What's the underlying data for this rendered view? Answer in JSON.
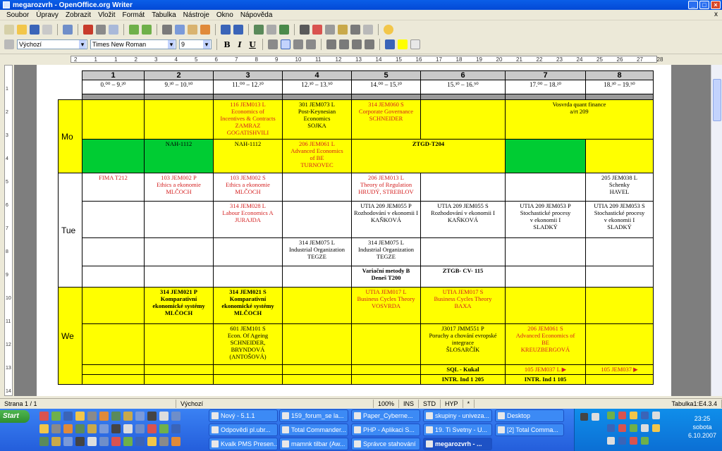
{
  "window": {
    "title": "megarozvrh - OpenOffice.org Writer"
  },
  "menu": [
    "Soubor",
    "Úpravy",
    "Zobrazit",
    "Vložit",
    "Formát",
    "Tabulka",
    "Nástroje",
    "Okno",
    "Nápověda"
  ],
  "menu_close": "x",
  "format_bar": {
    "style": "Výchozí",
    "font": "Times New Roman",
    "size": "9",
    "bold": "B",
    "italic": "I",
    "underline": "U"
  },
  "ruler": [
    "2",
    "1",
    "1",
    "2",
    "3",
    "4",
    "5",
    "6",
    "7",
    "8",
    "9",
    "10",
    "11",
    "12",
    "13",
    "14",
    "15",
    "16",
    "17",
    "18",
    "19",
    "20",
    "21",
    "22",
    "23",
    "24",
    "25",
    "26",
    "27",
    "28"
  ],
  "vruler": [
    "1",
    "2",
    "3",
    "4",
    "5",
    "6",
    "7",
    "8",
    "9",
    "10",
    "11",
    "12",
    "13",
    "14"
  ],
  "table": {
    "columns": [
      "1",
      "2",
      "3",
      "4",
      "5",
      "6",
      "7",
      "8"
    ],
    "times": [
      "0.⁰⁰ – 9.²⁰",
      "9.³⁰ – 10.⁵⁰",
      "11.⁰⁰ – 12.²⁰",
      "12.³⁰ – 13.⁵⁰",
      "14.⁰⁰ – 15.²⁰",
      "15.³⁰ – 16.⁵⁰",
      "17.⁰⁰ – 18.²⁰",
      "18.³⁰ – 19.⁵⁰"
    ],
    "days": {
      "mo": "Mo",
      "tue": "Tue",
      "we": "We"
    },
    "mo1": {
      "c3": [
        "116   JEM013   L",
        "Economics of",
        "Incentives & Contracts",
        "ZAMRAZ",
        "GOGATISHVILI"
      ],
      "c4": [
        "301   JEM073   L",
        "Post-Keynesian",
        "Economics",
        "SOJKA"
      ],
      "c5": [
        "314   JEM060   S",
        "Corporate Governance",
        "SCHNEIDER"
      ],
      "c7": [
        "Vosvrda quant finance",
        "a/rt 209"
      ]
    },
    "mo2": {
      "c2": "NAH-1112",
      "c3": "NAH-1112",
      "c4": [
        "206   JEM061   L",
        "Advanced Economics",
        "of BE",
        "TURNOVEC"
      ],
      "c56": "ZTGD-T204"
    },
    "tue1": {
      "c1": "FIMA T212",
      "c2": [
        "103   JEM002   P",
        "Ethics a ekonomie",
        "MLČOCH"
      ],
      "c3": [
        "103   JEM002   S",
        "Ethics a ekonomie",
        "MLČOCH"
      ],
      "c5": [
        "206   JEM013   L",
        "Theory of Regulation",
        "HRUDÝ, STREBLOV"
      ],
      "c8": [
        "205   JEM038   L",
        "Schenky",
        "HAVEL"
      ]
    },
    "tue2": {
      "c3": [
        "314   JEM028   L",
        "Labour Economics A",
        "JURAJDA"
      ],
      "c5": [
        "UTIA 209   JEM055   P",
        "Rozhodování v ekonomii I",
        "KAŇKOVÁ"
      ],
      "c6": [
        "UTIA 209   JEM055   S",
        "Rozhodování v ekonomii I",
        "KAŇKOVÁ"
      ],
      "c7": [
        "UTIA 209   JEM053   P",
        "Stochastické procesy",
        "v ekonomii I",
        "SLADKÝ"
      ],
      "c8": [
        "UTIA 209   JEM053   S",
        "Stochastické procesy",
        "v ekonomii I",
        "SLADKÝ"
      ]
    },
    "tue3": {
      "c4": [
        "314   JEM075   L",
        "Industrial Organization",
        "TEGZE"
      ],
      "c5": [
        "314   JEM075   L",
        "Industrial Organization",
        "TEGZE"
      ]
    },
    "tue4": {
      "c5": [
        "Variační metody B",
        "Deneš T200"
      ],
      "c6": "ZTGB- CV- 115"
    },
    "we1": {
      "c2": [
        "314   JEM021   P",
        "Komparativní",
        "ekonomické systémy",
        "MLČOCH"
      ],
      "c3": [
        "314   JEM021   S",
        "Komparativní",
        "ekonomické systémy",
        "MLČOCH"
      ],
      "c5": [
        "UTIA   JEM017   L",
        "Business Cycles Theory",
        "VOSVRDA"
      ],
      "c6": [
        "UTIA   JEM017   S",
        "Business Cycles Theory",
        "BAXA"
      ]
    },
    "we2": {
      "c3": [
        "601   JEM101   S",
        "Econ. Of Ageing",
        "SCHNEIDER,",
        "BRYNDOVÁ",
        "(ANTOŠOVÁ)"
      ],
      "c6": [
        "J3017   JMM551   P",
        "Poruchy a chování evropské",
        "integrace",
        "ŠLOSARČÍK"
      ],
      "c7": [
        "206   JEM061   S",
        "Advanced Economics of",
        "BE",
        "KREUZBERGOVÁ"
      ]
    },
    "we3": {
      "c6": "SQL - Kukal",
      "c7": "105   JEM037   L",
      "c8": "105   JEM037"
    },
    "we4": {
      "c6": "INTR. Ind 1 205",
      "c7": "INTR. Ind 1 105"
    }
  },
  "status": {
    "page": "Strana 1 / 1",
    "style": "Výchozí",
    "zoom": "100%",
    "ins": "INS",
    "std": "STD",
    "hyp": "HYP",
    "star": "*",
    "table": "Tabulka1:E4.3.4"
  },
  "taskbar": {
    "start": "Start",
    "tasks": [
      "Nový - 5.1.1",
      "159_forum_se la...",
      "Paper_Cyberne...",
      "skupiny - univeza...",
      "Desktop",
      "Odpovědi pl.ubr...",
      "Total Commander...",
      "PHP - Aplikaci S...",
      "19. Ti Svetny - U...",
      "[2] Total Comma...",
      "Kvalk PMS Presen...",
      "mamnk tilbar (Aw...",
      "Správce stahování",
      "megarozvrh - ..."
    ],
    "clock_time": "23:25",
    "clock_day": "sobota",
    "clock_date": "6.10.2007"
  },
  "colors": {
    "yellow": "#ffff00",
    "green": "#00cc33",
    "red_text": "#d42020"
  }
}
